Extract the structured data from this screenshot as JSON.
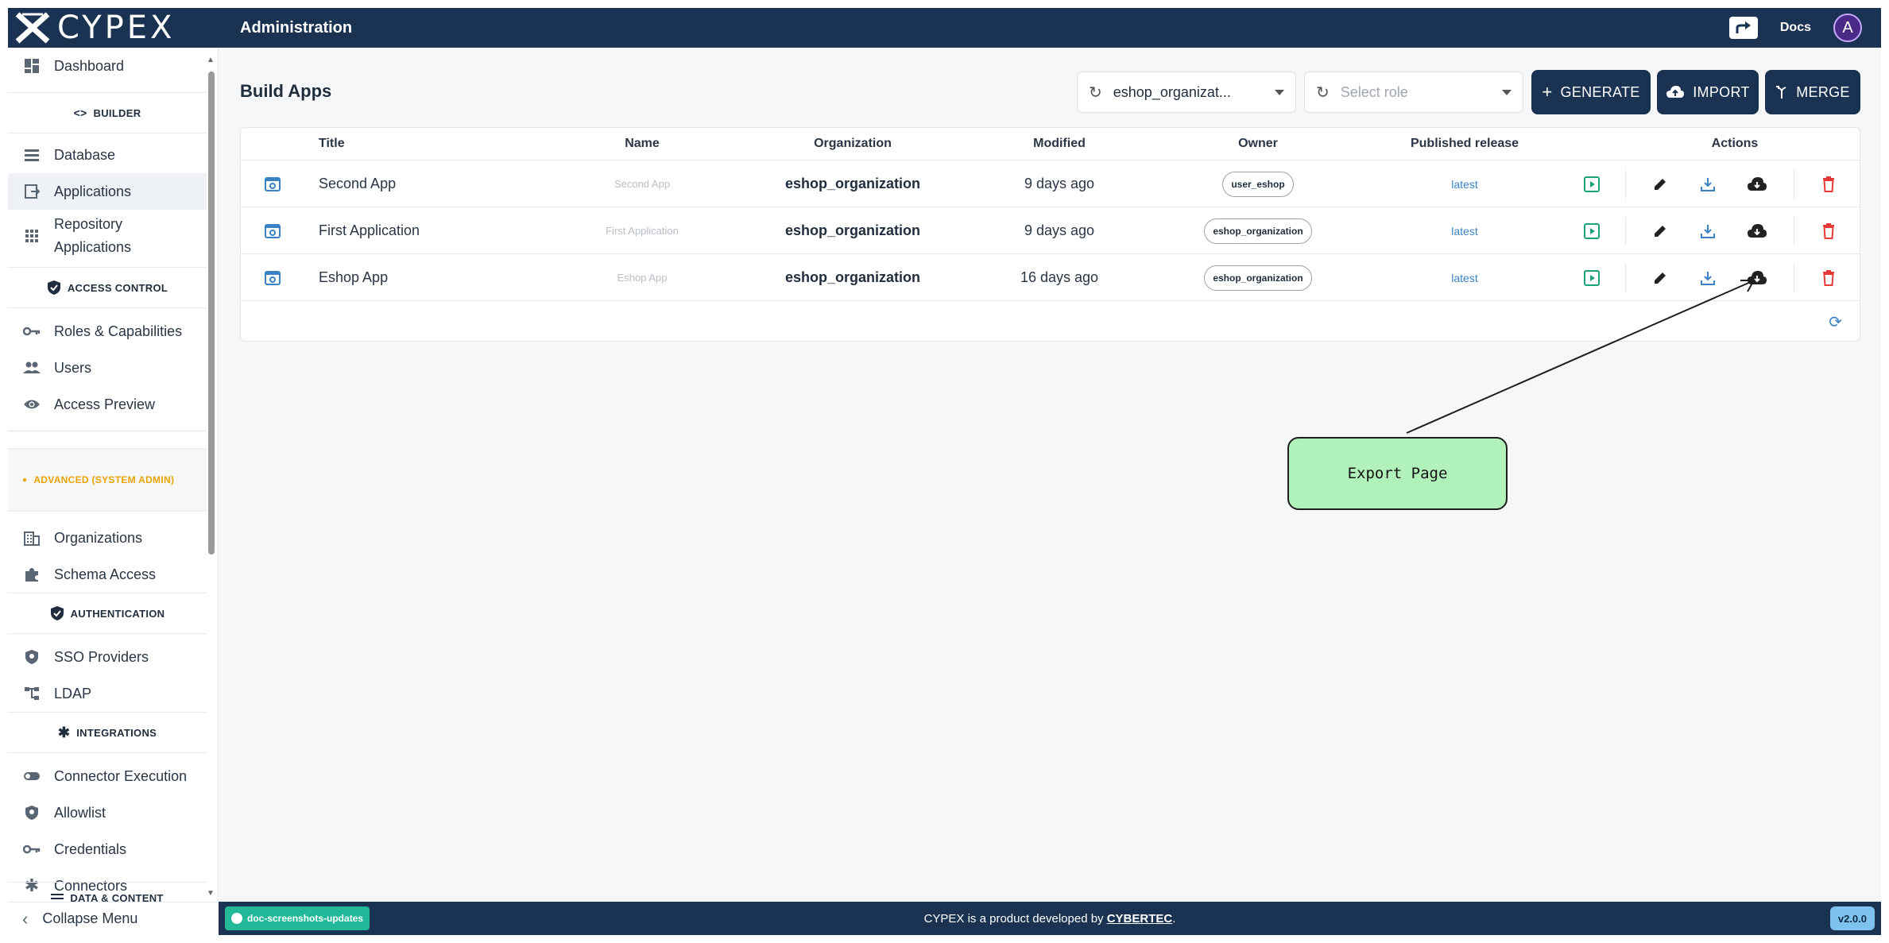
{
  "topbar": {
    "logo_text": "CYPEX",
    "title": "Administration",
    "docs_label": "Docs",
    "avatar_letter": "A"
  },
  "sidebar": {
    "items": {
      "dashboard": "Dashboard",
      "builder_section": "BUILDER",
      "database": "Database",
      "applications": "Applications",
      "repository_line1": "Repository",
      "repository_line2": "Applications",
      "access_control_section": "ACCESS CONTROL",
      "roles": "Roles & Capabilities",
      "users": "Users",
      "access_preview": "Access Preview",
      "advanced_section": "ADVANCED (SYSTEM ADMIN)",
      "organizations": "Organizations",
      "schema_access": "Schema Access",
      "authentication_section": "AUTHENTICATION",
      "sso": "SSO Providers",
      "ldap": "LDAP",
      "integrations_section": "INTEGRATIONS",
      "connector_execution": "Connector Execution",
      "allowlist": "Allowlist",
      "credentials": "Credentials",
      "connectors": "Connectors",
      "data_content_section": "DATA & CONTENT"
    },
    "collapse_label": "Collapse Menu"
  },
  "main": {
    "page_title": "Build Apps",
    "org_select_value": "eshop_organizat...",
    "role_select_placeholder": "Select role",
    "generate_label": "GENERATE",
    "import_label": "IMPORT",
    "merge_label": "MERGE",
    "columns": {
      "title": "Title",
      "name": "Name",
      "organization": "Organization",
      "modified": "Modified",
      "owner": "Owner",
      "published": "Published release",
      "actions": "Actions"
    },
    "rows": [
      {
        "title": "Second App",
        "name": "Second App",
        "organization": "eshop_organization",
        "modified": "9 days ago",
        "owner": "user_eshop",
        "published": "latest"
      },
      {
        "title": "First Application",
        "name": "First Application",
        "organization": "eshop_organization",
        "modified": "9 days ago",
        "owner": "eshop_organization",
        "published": "latest"
      },
      {
        "title": "Eshop App",
        "name": "Eshop App",
        "organization": "eshop_organization",
        "modified": "16 days ago",
        "owner": "eshop_organization",
        "published": "latest"
      }
    ]
  },
  "annotation": {
    "label": "Export Page"
  },
  "footer": {
    "branch": "doc-screenshots-updates",
    "text_prefix": "CYPEX is a product developed by ",
    "link_text": "CYBERTEC",
    "text_suffix": ".",
    "version": "v2.0.0"
  },
  "colors": {
    "navy": "#1b3352",
    "accent_green": "#1aa37a",
    "accent_blue": "#3b82c4",
    "delete_red": "#e53935",
    "callout_fill": "#b1f2ba",
    "advanced_orange": "#e8a400"
  }
}
